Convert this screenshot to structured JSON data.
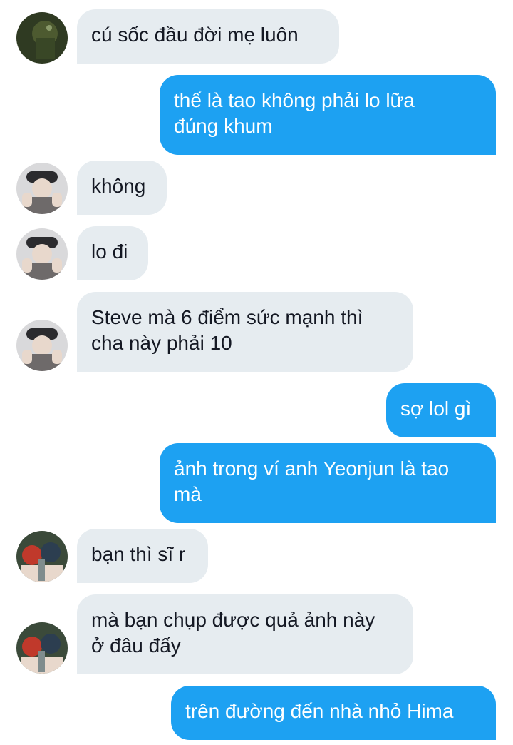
{
  "colors": {
    "incoming_bubble": "#e6ecf0",
    "outgoing_bubble": "#1da1f2",
    "incoming_text": "#141823",
    "outgoing_text": "#ffffff"
  },
  "avatars": {
    "a1": "dark-green-avatar",
    "a2": "hat-person-avatar",
    "a3": "anime-group-avatar"
  },
  "messages": [
    {
      "from": "them",
      "avatar": "a1",
      "text": "cú sốc đầu đời mẹ luôn"
    },
    {
      "from": "me",
      "text": "thế là tao không phải lo lữa\nđúng khum"
    },
    {
      "from": "them",
      "avatar": "a2",
      "text": "không"
    },
    {
      "from": "them",
      "avatar": "a2",
      "text": "lo đi"
    },
    {
      "from": "them",
      "avatar": "a2",
      "text": "Steve mà 6 điểm sức mạnh thì\ncha này phải 10"
    },
    {
      "from": "me",
      "text": "sợ lol gì"
    },
    {
      "from": "me",
      "text": "ảnh trong ví anh Yeonjun là tao\nmà"
    },
    {
      "from": "them",
      "avatar": "a3",
      "text": "bạn thì sĩ r"
    },
    {
      "from": "them",
      "avatar": "a3",
      "text": "mà bạn chụp được quả ảnh này\nở đâu đấy"
    },
    {
      "from": "me",
      "text": "trên đường đến nhà nhỏ Hima"
    }
  ]
}
